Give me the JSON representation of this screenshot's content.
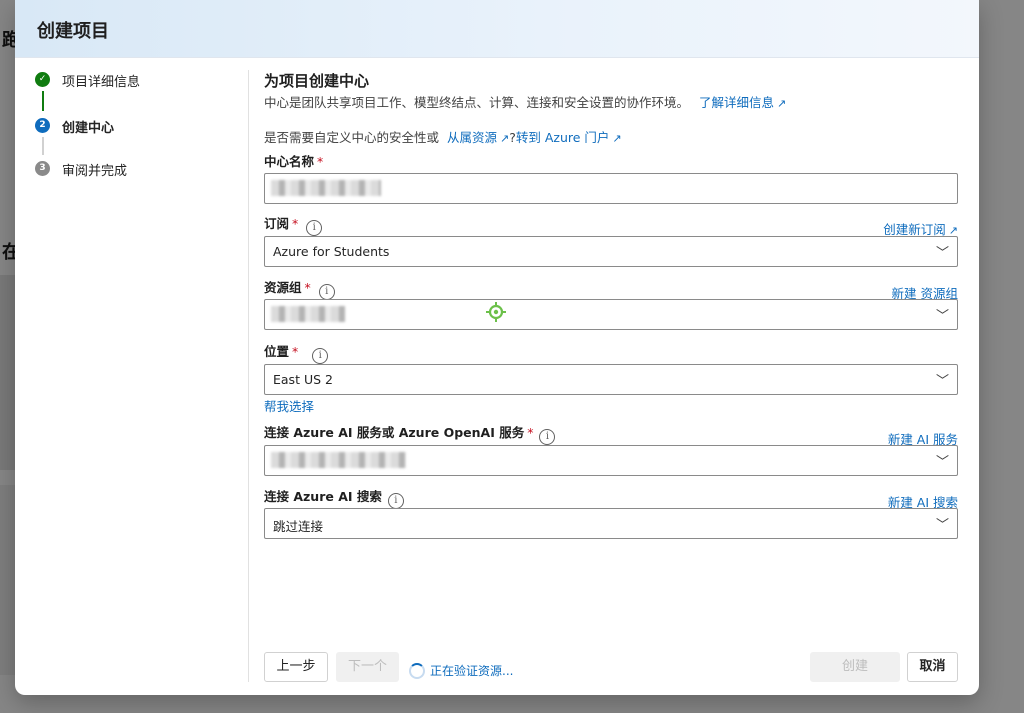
{
  "background": {
    "frag1": "跑",
    "frag2": "在"
  },
  "dialog": {
    "title": "创建项目"
  },
  "steps": [
    {
      "label": "项目详细信息",
      "state": "done",
      "marker": "✓"
    },
    {
      "label": "创建中心",
      "state": "current",
      "marker": "2"
    },
    {
      "label": "审阅并完成",
      "state": "pending",
      "marker": "3"
    }
  ],
  "content": {
    "title": "为项目创建中心",
    "description": "中心是团队共享项目工作、模型终结点、计算、连接和安全设置的协作环境。",
    "learn_more": "了解详细信息",
    "custom_prefix": "是否需要自定义中心的安全性或",
    "custom_link1": "从属资源",
    "custom_mid": "?",
    "custom_link2": "转到 Azure 门户"
  },
  "form": {
    "hub_name": {
      "label": "中心名称",
      "required": "*",
      "value": ""
    },
    "subscription": {
      "label": "订阅",
      "required": "*",
      "value": "Azure for Students",
      "new_link": "创建新订阅"
    },
    "resource_group": {
      "label": "资源组",
      "required": "*",
      "value": "",
      "new_link": "新建 资源组"
    },
    "location": {
      "label": "位置",
      "required": "*",
      "value": "East US 2",
      "help_link": "帮我选择"
    },
    "ai_service": {
      "label": "连接 Azure AI 服务或 Azure OpenAI 服务",
      "required": "*",
      "value": "",
      "new_link": "新建 AI 服务"
    },
    "ai_search": {
      "label": "连接 Azure AI 搜索",
      "value": "跳过连接",
      "new_link": "新建 AI 搜索"
    }
  },
  "footer": {
    "back": "上一步",
    "next": "下一个",
    "validating": "正在验证资源...",
    "create": "创建",
    "cancel": "取消"
  },
  "colors": {
    "accent": "#0f6cbd",
    "success": "#107c10",
    "required": "#c50f1f",
    "cursor_marker": "#6cc04a"
  },
  "icons": {
    "ext": "↗",
    "chevron": "﹀",
    "info": "i"
  }
}
